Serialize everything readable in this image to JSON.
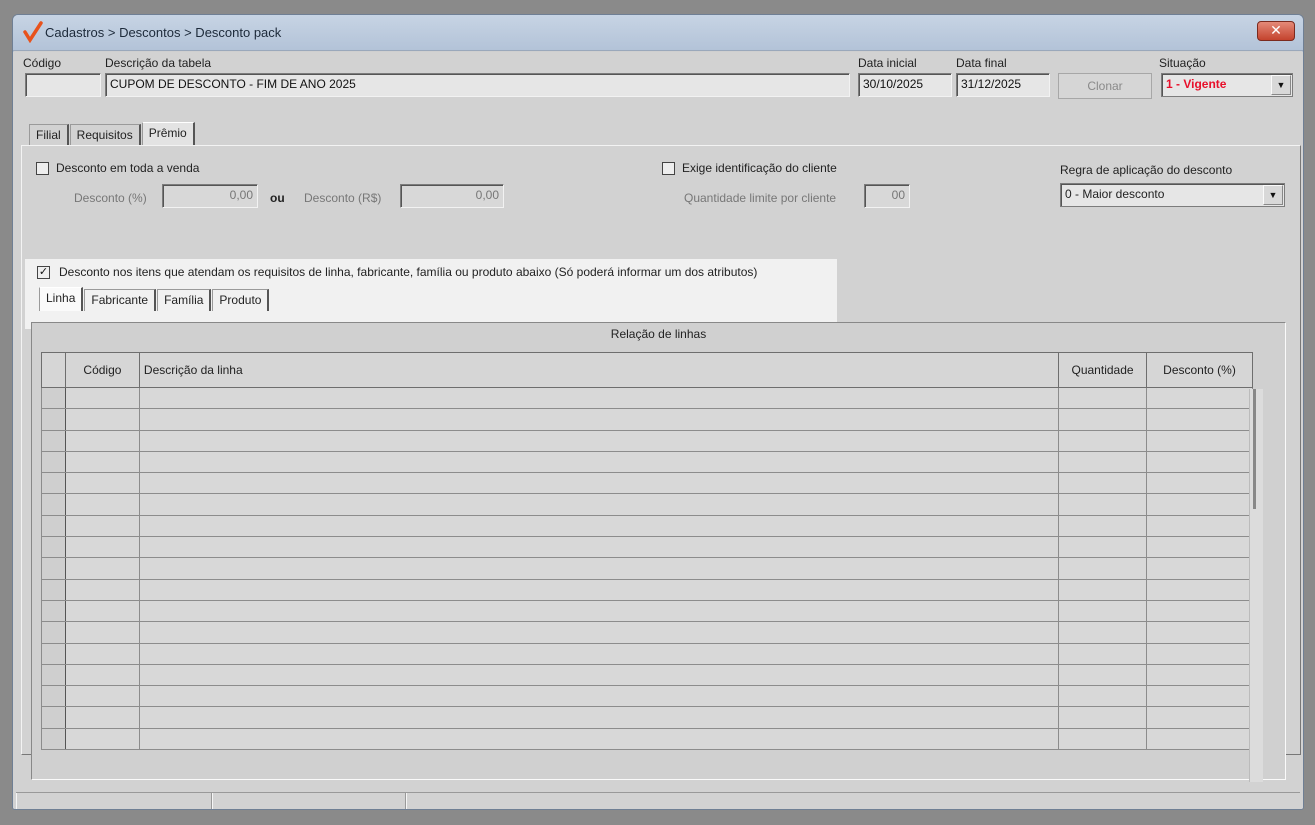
{
  "window": {
    "title": "Cadastros > Descontos > Desconto pack",
    "close_glyph": "✕"
  },
  "header": {
    "codigo_label": "Código",
    "codigo_value": "",
    "descricao_label": "Descrição da tabela",
    "descricao_value": "CUPOM DE DESCONTO - FIM DE ANO 2025",
    "data_inicial_label": "Data inicial",
    "data_inicial_value": "30/10/2025",
    "data_final_label": "Data final",
    "data_final_value": "31/12/2025",
    "clonar_label": "Clonar",
    "situacao_label": "Situação",
    "situacao_value": "1 - Vigente"
  },
  "main_tabs": [
    {
      "label": "Filial"
    },
    {
      "label": "Requisitos"
    },
    {
      "label": "Prêmio",
      "active": true
    }
  ],
  "premio": {
    "desconto_toda_venda_label": "Desconto em toda a venda",
    "desconto_pct_label": "Desconto (%)",
    "desconto_pct_value": "0,00",
    "ou_label": "ou",
    "desconto_rs_label": "Desconto (R$)",
    "desconto_rs_value": "0,00",
    "exige_id_label": "Exige identificação do cliente",
    "qtd_limite_label": "Quantidade limite por cliente",
    "qtd_limite_value": "00",
    "regra_label": "Regra de aplicação do desconto",
    "regra_value": "0 - Maior desconto",
    "desconto_itens_label": "Desconto nos itens que atendam os requisitos de linha, fabricante, família ou produto abaixo (Só poderá informar um dos atributos)",
    "desconto_itens_checked": "✓"
  },
  "sub_tabs": [
    {
      "label": "Linha",
      "active": true
    },
    {
      "label": "Fabricante"
    },
    {
      "label": "Família"
    },
    {
      "label": "Produto"
    }
  ],
  "grid": {
    "title": "Relação de linhas",
    "columns": [
      "Código",
      "Descrição da linha",
      "Quantidade",
      "Desconto (%)"
    ],
    "row_count": 17
  },
  "icons": {
    "dropdown": "▼",
    "app": "check-logo-icon"
  },
  "colors": {
    "accent_red": "#e8102b",
    "titlebar": "#b3c3d8"
  }
}
